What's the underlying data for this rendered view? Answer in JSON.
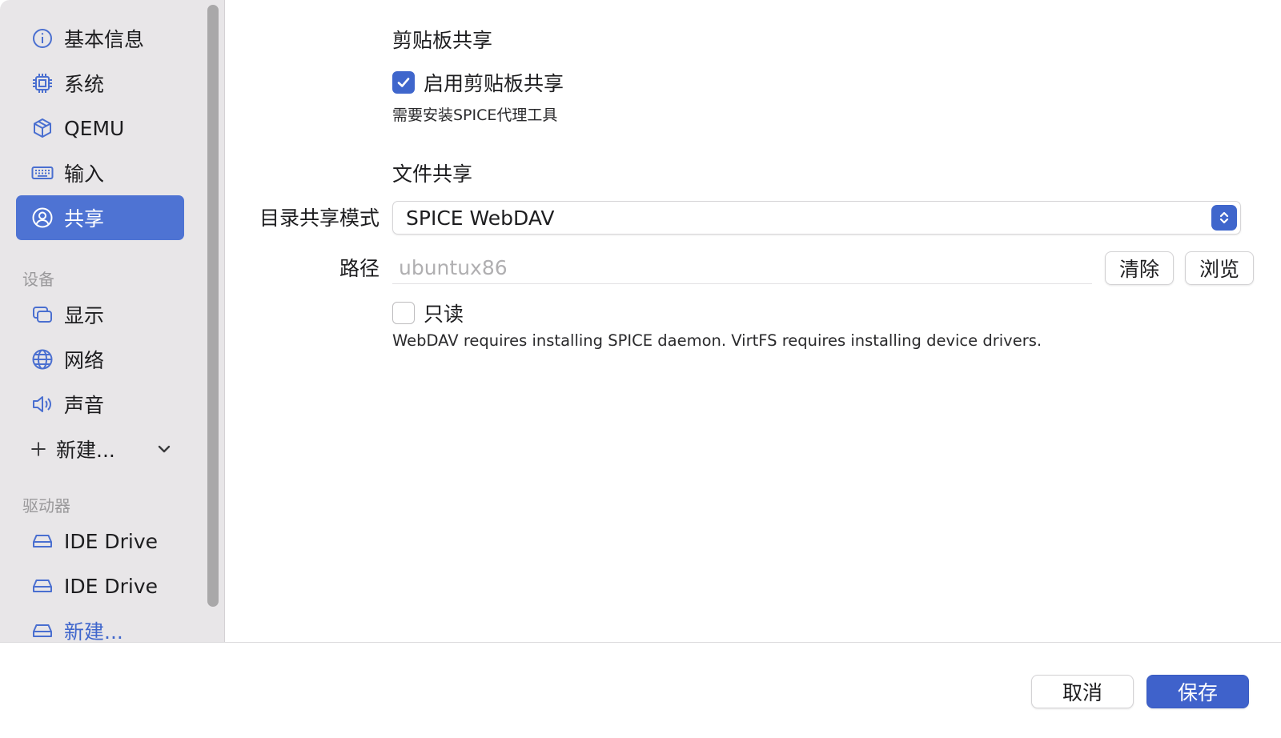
{
  "sidebar": {
    "items": [
      {
        "label": "基本信息",
        "icon": "info-icon",
        "active": false
      },
      {
        "label": "系统",
        "icon": "cpu-chip-icon",
        "active": false
      },
      {
        "label": "QEMU",
        "icon": "cube-icon",
        "active": false
      },
      {
        "label": "输入",
        "icon": "keyboard-icon",
        "active": false
      },
      {
        "label": "共享",
        "icon": "person-circle-icon",
        "active": true
      }
    ],
    "devices_section": "设备",
    "device_items": [
      {
        "label": "显示",
        "icon": "display-windows-icon"
      },
      {
        "label": "网络",
        "icon": "globe-icon"
      },
      {
        "label": "声音",
        "icon": "speaker-icon"
      }
    ],
    "new_device_label": "新建...",
    "drives_section": "驱动器",
    "drive_items": [
      {
        "label": "IDE Drive",
        "icon": "drive-icon"
      },
      {
        "label": "IDE Drive",
        "icon": "drive-icon"
      },
      {
        "label": "新建...",
        "icon": "drive-add-icon"
      }
    ]
  },
  "clipboard": {
    "title": "剪贴板共享",
    "enable_label": "启用剪贴板共享",
    "enabled": true,
    "hint": "需要安装SPICE代理工具"
  },
  "file_sharing": {
    "title": "文件共享",
    "mode_label": "目录共享模式",
    "mode_value": "SPICE WebDAV",
    "path_label": "路径",
    "path_placeholder": "ubuntux86",
    "clear_label": "清除",
    "browse_label": "浏览",
    "readonly_label": "只读",
    "readonly": false,
    "note": "WebDAV requires installing SPICE daemon. VirtFS requires installing device drivers."
  },
  "footer": {
    "cancel_label": "取消",
    "save_label": "保存"
  },
  "colors": {
    "accent": "#3f66cc",
    "sidebar_bg": "#e8e6e8",
    "sidebar_active": "#4e73d3"
  }
}
